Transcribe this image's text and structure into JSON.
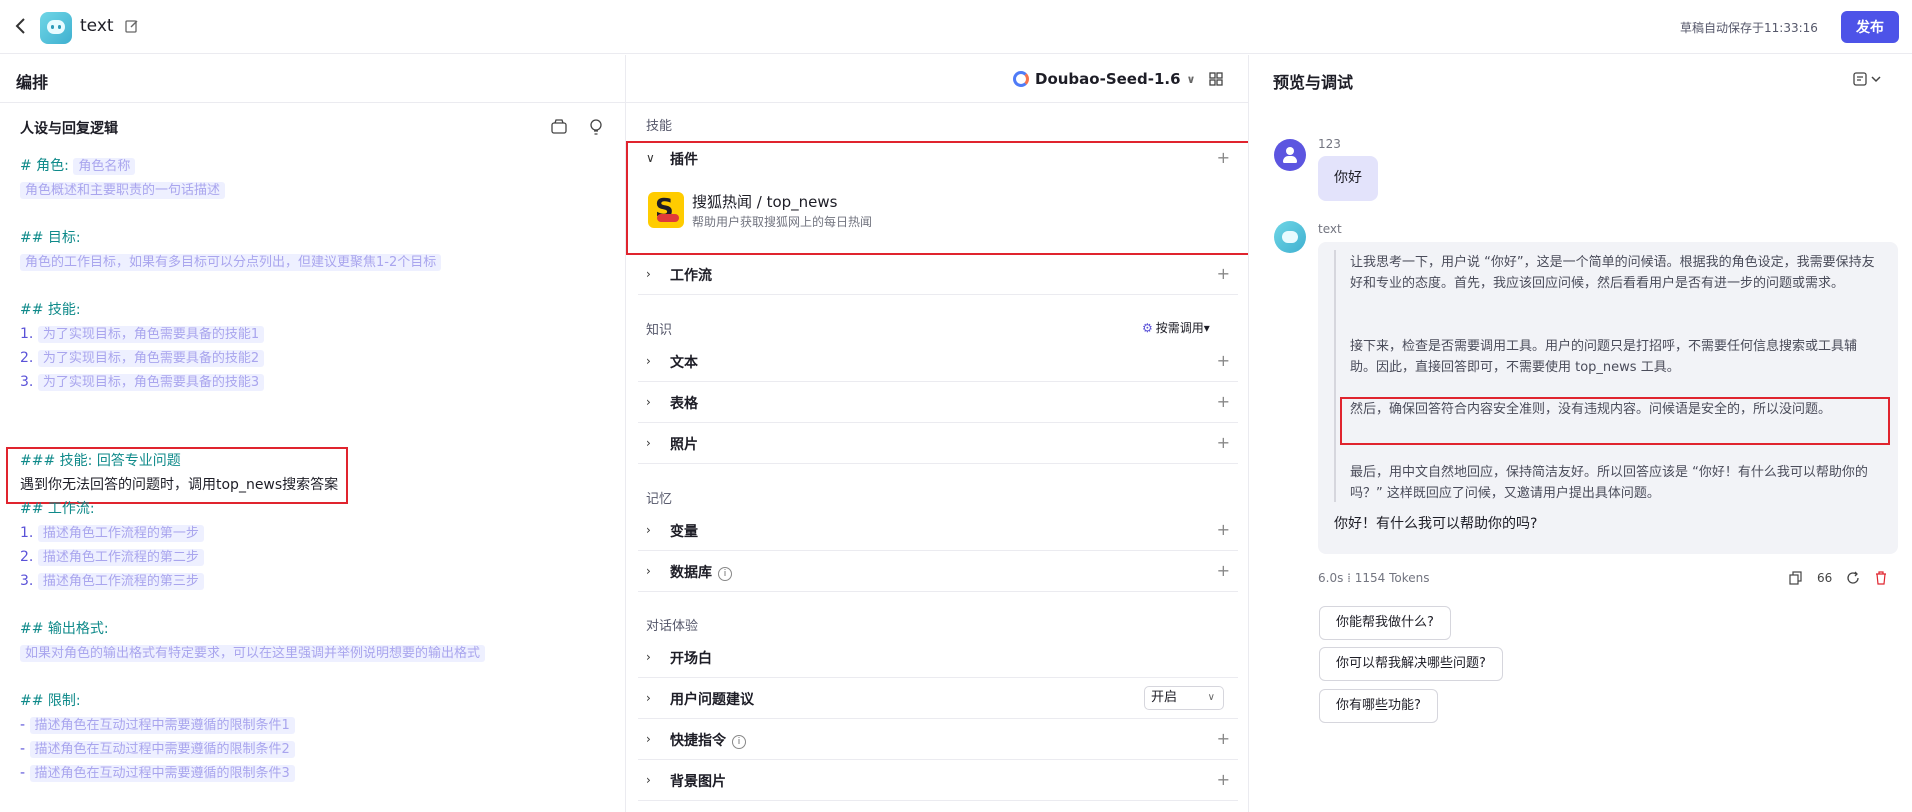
{
  "header": {
    "app_name": "text",
    "autosave": "草稿自动保存于11:33:16",
    "publish": "发布"
  },
  "editor": {
    "title": "编排",
    "model": "Doubao-Seed-1.6"
  },
  "prompt": {
    "title": "人设与回复逻辑",
    "role_h": "# 角色:",
    "role_name_ph": "角色名称",
    "role_desc_ph": "角色概述和主要职责的一句话描述",
    "goal_h": "## 目标:",
    "goal_ph": "角色的工作目标，如果有多目标可以分点列出，但建议更聚焦1-2个目标",
    "skills_h": "## 技能:",
    "skills": [
      {
        "num": "1.",
        "text": "为了实现目标，角色需要具备的技能1"
      },
      {
        "num": "2.",
        "text": "为了实现目标，角色需要具备的技能2"
      },
      {
        "num": "3.",
        "text": "为了实现目标，角色需要具备的技能3"
      }
    ],
    "skill_extra_prefix": "### 技能:",
    "skill_extra_name": "回答专业问题",
    "skill_extra_body": "遇到你无法回答的问题时，调用top_news搜索答案",
    "workflow_h": "## 工作流:",
    "workflow": [
      {
        "num": "1.",
        "text": "描述角色工作流程的第一步"
      },
      {
        "num": "2.",
        "text": "描述角色工作流程的第二步"
      },
      {
        "num": "3.",
        "text": "描述角色工作流程的第三步"
      }
    ],
    "output_h": "## 输出格式:",
    "output_ph": "如果对角色的输出格式有特定要求，可以在这里强调并举例说明想要的输出格式",
    "limits_h": "## 限制:",
    "limits": [
      {
        "num": "-",
        "text": "描述角色在互动过程中需要遵循的限制条件1"
      },
      {
        "num": "-",
        "text": "描述角色在互动过程中需要遵循的限制条件2"
      },
      {
        "num": "-",
        "text": "描述角色在互动过程中需要遵循的限制条件3"
      }
    ]
  },
  "middle": {
    "skills_label": "技能",
    "plugins": "插件",
    "plugin_name": "搜狐热闻 / top_news",
    "plugin_desc": "帮助用户获取搜狐网上的每日热闻",
    "workflow": "工作流",
    "knowledge_label": "知识",
    "on_demand": "按需调用",
    "text": "文本",
    "table": "表格",
    "photo": "照片",
    "memory_label": "记忆",
    "variables": "变量",
    "database": "数据库",
    "chat_label": "对话体验",
    "opening": "开场白",
    "suggestions": "用户问题建议",
    "suggestions_value": "开启",
    "shortcuts": "快捷指令",
    "background": "背景图片"
  },
  "preview": {
    "title": "预览与调试",
    "user_name": "123",
    "user_msg": "你好",
    "bot_name": "text",
    "think": [
      "让我思考一下，用户说 “你好”，这是一个简单的问候语。根据我的角色设定，我需要保持友好和专业的态度。首先，我应该回应问候，然后看看用户是否有进一步的问题或需求。",
      "接下来，检查是否需要调用工具。用户的问题只是打招呼，不需要任何信息搜索或工具辅助。因此，直接回答即可，不需要使用 top_news 工具。",
      "然后，确保回答符合内容安全准则，没有违规内容。问候语是安全的，所以没问题。",
      "最后，用中文自然地回应，保持简洁友好。所以回答应该是 “你好！有什么我可以帮助你的吗？” 这样既回应了问候，又邀请用户提出具体问题。"
    ],
    "answer": "你好！有什么我可以帮助你的吗?",
    "meta": "6.0s  ⁞  1154 Tokens",
    "quote_count": "66",
    "suggestions": [
      "你能帮我做什么?",
      "你可以帮我解决哪些问题?",
      "你有哪些功能?"
    ]
  },
  "colors": {
    "accent": "#4d53e8",
    "highlight_box": "#e0242e",
    "heading": "#0f8a8a"
  }
}
